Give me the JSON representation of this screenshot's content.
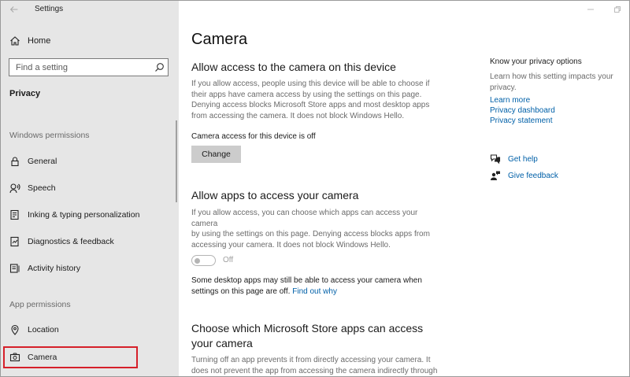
{
  "window": {
    "title": "Settings",
    "controls": [
      "minimize",
      "maximize"
    ]
  },
  "sidebar": {
    "home_label": "Home",
    "search_placeholder": "Find a setting",
    "privacy_label": "Privacy",
    "windows_permissions_header": "Windows permissions",
    "windows_items": [
      {
        "label": "General",
        "icon": "lock-icon"
      },
      {
        "label": "Speech",
        "icon": "speech-icon"
      },
      {
        "label": "Inking & typing personalization",
        "icon": "inking-icon"
      },
      {
        "label": "Diagnostics & feedback",
        "icon": "diagnostics-icon"
      },
      {
        "label": "Activity history",
        "icon": "activity-icon"
      }
    ],
    "app_permissions_header": "App permissions",
    "app_items": [
      {
        "label": "Location",
        "icon": "location-icon"
      },
      {
        "label": "Camera",
        "icon": "camera-icon",
        "selected": true
      }
    ],
    "selection_outline_color": "#d6202a"
  },
  "main": {
    "title": "Camera",
    "device_section": {
      "heading": "Allow access to the camera on this device",
      "desc_lines": [
        "If you allow access, people using this device will be able to choose if",
        "their apps have camera access by using the settings on this page.",
        "Denying access blocks Microsoft Store apps and most desktop apps",
        "from accessing the camera. It does not block Windows Hello."
      ],
      "status": "Camera access for this device is off",
      "change_button": "Change"
    },
    "apps_section": {
      "heading": "Allow apps to access your camera",
      "desc_lines": [
        "If you allow access, you can choose which apps can access your camera",
        "by using the settings on this page. Denying access blocks apps from",
        "accessing your camera. It does not block Windows Hello."
      ],
      "toggle_state": "Off",
      "note_line1": "Some desktop apps may still be able to access your camera when",
      "note_line2": "settings on this page are off.",
      "find_out_why": "Find out why"
    },
    "store_section": {
      "heading_line1": "Choose which Microsoft Store apps can access",
      "heading_line2": "your camera",
      "desc_lines": [
        "Turning off an app prevents it from directly accessing your camera. It",
        "does not prevent the app from accessing the camera indirectly through"
      ]
    }
  },
  "right_panel": {
    "title": "Know your privacy options",
    "desc_lines": [
      "Learn how this setting impacts your",
      "privacy."
    ],
    "links": [
      "Learn more",
      "Privacy dashboard",
      "Privacy statement"
    ],
    "get_help": "Get help",
    "give_feedback": "Give feedback",
    "link_color": "#0060a8"
  }
}
